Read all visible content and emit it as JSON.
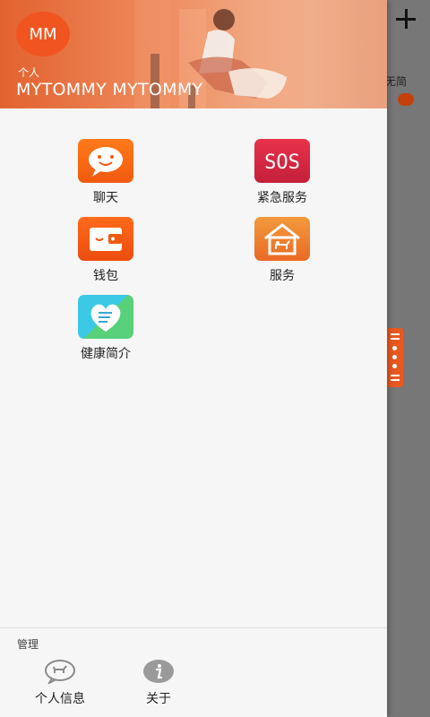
{
  "header": {
    "avatar_text": "MM",
    "subtitle": "个人",
    "name": "MYTOMMY MYTOMMY"
  },
  "background": {
    "label": "无简",
    "handle_icon": "drawer-handle-icon"
  },
  "menu": [
    {
      "label": "聊天",
      "icon": "chat-icon"
    },
    {
      "label": "紧急服务",
      "icon": "sos-icon",
      "icon_text": "SOS"
    },
    {
      "label": "钱包",
      "icon": "wallet-icon"
    },
    {
      "label": "服务",
      "icon": "dog-house-icon"
    },
    {
      "label": "健康简介",
      "icon": "health-heart-icon"
    }
  ],
  "footer": {
    "title": "管理",
    "items": [
      {
        "label": "个人信息",
        "icon": "dog-chat-icon"
      },
      {
        "label": "关于",
        "icon": "info-icon"
      }
    ]
  },
  "colors": {
    "accent": "#f1551f",
    "sos": "#d62840",
    "drawer_bg": "#f6f6f6"
  }
}
